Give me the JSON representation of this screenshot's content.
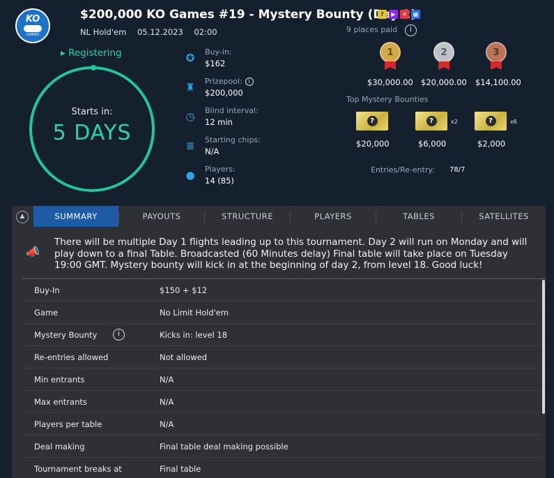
{
  "header": {
    "logo_text": "KO",
    "logo_sub": "GAMES",
    "title": "$200,000 KO Games #19 - Mystery Bounty (Day 2)",
    "game": "NL Hold'em",
    "date": "05.12.2023",
    "time": "02:00"
  },
  "status": {
    "registering": "Registering",
    "starts_in_label": "Starts in:",
    "countdown": "5 DAYS"
  },
  "info": {
    "buyin_label": "Buy-in:",
    "buyin_value": "$162",
    "prizepool_label": "Prizepool:",
    "prizepool_value": "$200,000",
    "blind_label": "Blind interval:",
    "blind_value": "12 min",
    "chips_label": "Starting chips:",
    "chips_value": "N/A",
    "players_label": "Players:",
    "players_value": "14 (85)"
  },
  "payouts": {
    "places_paid": "9 places paid",
    "prizes": [
      {
        "rank": "1",
        "amount": "$30,000.00",
        "color": "#d4a94a"
      },
      {
        "rank": "2",
        "amount": "$20,000.00",
        "color": "#bfc3c8"
      },
      {
        "rank": "3",
        "amount": "$14,100.00",
        "color": "#b8735a"
      }
    ]
  },
  "bounties": {
    "label": "Top Mystery Bounties",
    "items": [
      {
        "amount": "$20,000",
        "mult": ""
      },
      {
        "amount": "$6,000",
        "mult": "x2"
      },
      {
        "amount": "$2,000",
        "mult": "x6"
      }
    ],
    "entries_label": "Entries/Re-entry:",
    "entries_value": "78/7"
  },
  "tabs": [
    "SUMMARY",
    "PAYOUTS",
    "STRUCTURE",
    "PLAYERS",
    "TABLES",
    "SATELLITES"
  ],
  "announcement": "There will be multiple Day 1 flights leading up to this tournament. Day 2 will run on Monday and will play down to a final Table. Broadcasted (60 Minutes delay) Final table will take place on Tuesday 19:00 GMT. Mystery bounty will kick in at the beginning of day 2, from level 18. Good luck!",
  "summary": [
    {
      "key": "Buy-In",
      "value": "$150 + $12"
    },
    {
      "key": "Game",
      "value": "No Limit Hold'em"
    },
    {
      "key": "Mystery Bounty",
      "value": "Kicks in: level 18"
    },
    {
      "key": "Re-entries allowed",
      "value": "Not allowed"
    },
    {
      "key": "Min entrants",
      "value": "N/A"
    },
    {
      "key": "Max entrants",
      "value": "N/A"
    },
    {
      "key": "Players per table",
      "value": "N/A"
    },
    {
      "key": "Deal making",
      "value": "Final table deal making possible"
    },
    {
      "key": "Tournament breaks at",
      "value": "Final table"
    }
  ]
}
